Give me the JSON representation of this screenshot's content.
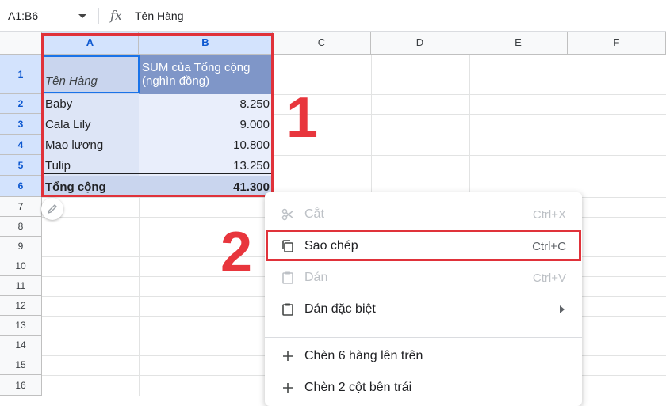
{
  "formula_bar": {
    "name_box": "A1:B6",
    "fx_label": "fx",
    "content": "Tên Hàng"
  },
  "columns": [
    "A",
    "B",
    "C",
    "D",
    "E",
    "F"
  ],
  "rows": [
    "1",
    "2",
    "3",
    "4",
    "5",
    "6",
    "7",
    "8",
    "9",
    "10",
    "11",
    "12",
    "13",
    "14",
    "15",
    "16"
  ],
  "pivot": {
    "header_a": "Tên Hàng",
    "header_b_line1": "SUM của Tổng cộng",
    "header_b_line2": "(nghìn đồng)",
    "items": [
      {
        "name": "Baby",
        "value": "8.250"
      },
      {
        "name": "Cala Lily",
        "value": "9.000"
      },
      {
        "name": "Mao lương",
        "value": "10.800"
      },
      {
        "name": "Tulip",
        "value": "13.250"
      }
    ],
    "total_label": "Tổng cộng",
    "total_value": "41.300"
  },
  "annotations": {
    "step1": "1",
    "step2": "2"
  },
  "context_menu": {
    "cut": {
      "label": "Cắt",
      "shortcut": "Ctrl+X"
    },
    "copy": {
      "label": "Sao chép",
      "shortcut": "Ctrl+C"
    },
    "paste": {
      "label": "Dán",
      "shortcut": "Ctrl+V"
    },
    "paste_special": {
      "label": "Dán đặc biệt"
    },
    "insert_rows": {
      "label": "Chèn 6 hàng lên trên"
    },
    "insert_cols": {
      "label": "Chèn 2 cột bên trái"
    }
  },
  "colors": {
    "accent_red": "#e0323a",
    "selection_blue": "#1a73e8",
    "pivot_header": "#7f96c8",
    "pivot_body": "#e6edfb"
  }
}
